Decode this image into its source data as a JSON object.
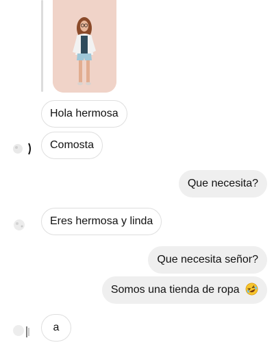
{
  "conversation": {
    "shared_image": {
      "icon": "photo-of-woman"
    },
    "messages": [
      {
        "side": "incoming",
        "text": "Hola hermosa"
      },
      {
        "side": "incoming",
        "text": "Comosta"
      },
      {
        "side": "outgoing",
        "text": "Que necesita?"
      },
      {
        "side": "incoming",
        "text": "Eres hermosa y linda"
      },
      {
        "side": "outgoing",
        "text": "Que necesita señor?"
      },
      {
        "side": "outgoing",
        "text": "Somos una tienda de ropa",
        "emoji": "rolling-on-floor-laughing-emoji"
      },
      {
        "side": "incoming",
        "text": "a"
      }
    ]
  },
  "colors": {
    "incoming_bubble": "#ffffff",
    "incoming_border": "#dedede",
    "outgoing_bubble": "#efefef",
    "text": "#111111",
    "photo_background": "#f0d3c8"
  }
}
